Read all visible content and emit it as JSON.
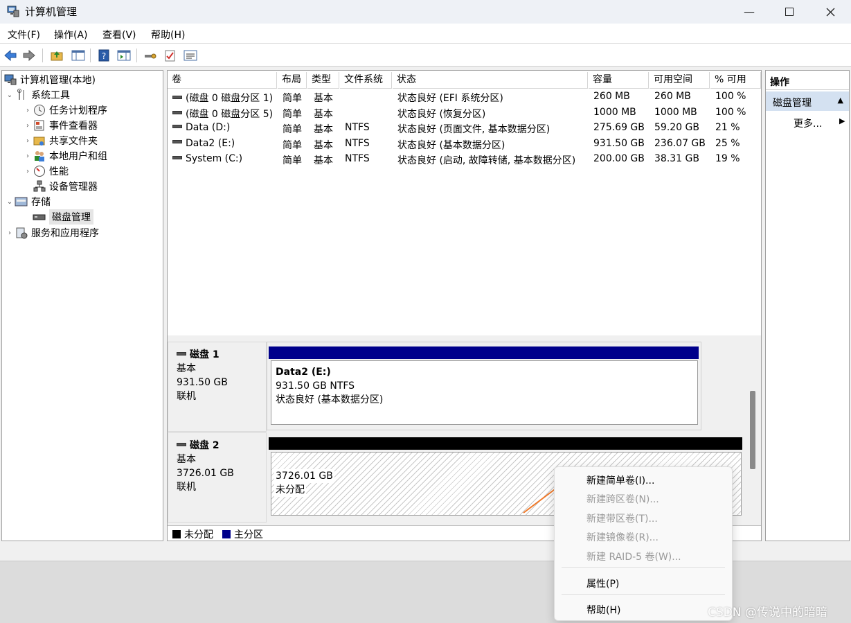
{
  "window": {
    "title": "计算机管理"
  },
  "menubar": {
    "items": [
      "文件(F)",
      "操作(A)",
      "查看(V)",
      "帮助(H)"
    ]
  },
  "tree": {
    "root": "计算机管理(本地)",
    "system_tools": "系统工具",
    "task_scheduler": "任务计划程序",
    "event_viewer": "事件查看器",
    "shared_folders": "共享文件夹",
    "local_users": "本地用户和组",
    "performance": "性能",
    "device_manager": "设备管理器",
    "storage": "存储",
    "disk_management": "磁盘管理",
    "services_apps": "服务和应用程序"
  },
  "volumes": {
    "headers": [
      "卷",
      "布局",
      "类型",
      "文件系统",
      "状态",
      "容量",
      "可用空间",
      "% 可用"
    ],
    "rows": [
      [
        "(磁盘 0 磁盘分区 1)",
        "简单",
        "基本",
        "",
        "状态良好 (EFI 系统分区)",
        "260 MB",
        "260 MB",
        "100 %"
      ],
      [
        "(磁盘 0 磁盘分区 5)",
        "简单",
        "基本",
        "",
        "状态良好 (恢复分区)",
        "1000 MB",
        "1000 MB",
        "100 %"
      ],
      [
        "Data (D:)",
        "简单",
        "基本",
        "NTFS",
        "状态良好 (页面文件, 基本数据分区)",
        "275.69 GB",
        "59.20 GB",
        "21 %"
      ],
      [
        "Data2 (E:)",
        "简单",
        "基本",
        "NTFS",
        "状态良好 (基本数据分区)",
        "931.50 GB",
        "236.07 GB",
        "25 %"
      ],
      [
        "System (C:)",
        "简单",
        "基本",
        "NTFS",
        "状态良好 (启动, 故障转储, 基本数据分区)",
        "200.00 GB",
        "38.31 GB",
        "19 %"
      ]
    ]
  },
  "disks": [
    {
      "name": "磁盘 1",
      "type": "基本",
      "size": "931.50 GB",
      "status": "联机",
      "partition": {
        "title": "Data2  (E:)",
        "detail": "931.50 GB NTFS",
        "status": "状态良好 (基本数据分区)"
      }
    },
    {
      "name": "磁盘 2",
      "type": "基本",
      "size": "3726.01 GB",
      "status": "联机",
      "partition": {
        "detail": "3726.01 GB",
        "status": "未分配"
      }
    }
  ],
  "legend": {
    "unallocated": "未分配",
    "primary": "主分区"
  },
  "actions": {
    "header": "操作",
    "section": "磁盘管理",
    "more": "更多..."
  },
  "context_menu": {
    "new_simple": "新建简单卷(I)...",
    "new_spanned": "新建跨区卷(N)...",
    "new_striped": "新建带区卷(T)...",
    "new_mirrored": "新建镜像卷(R)...",
    "new_raid5": "新建 RAID-5 卷(W)...",
    "properties": "属性(P)",
    "help": "帮助(H)"
  },
  "watermark": "CSDN @传说中的暗暗",
  "colors": {
    "primary_partition": "#00008b",
    "unallocated": "#000000",
    "action_selected": "#d4e1f1",
    "arrow": "#f07a2a"
  }
}
